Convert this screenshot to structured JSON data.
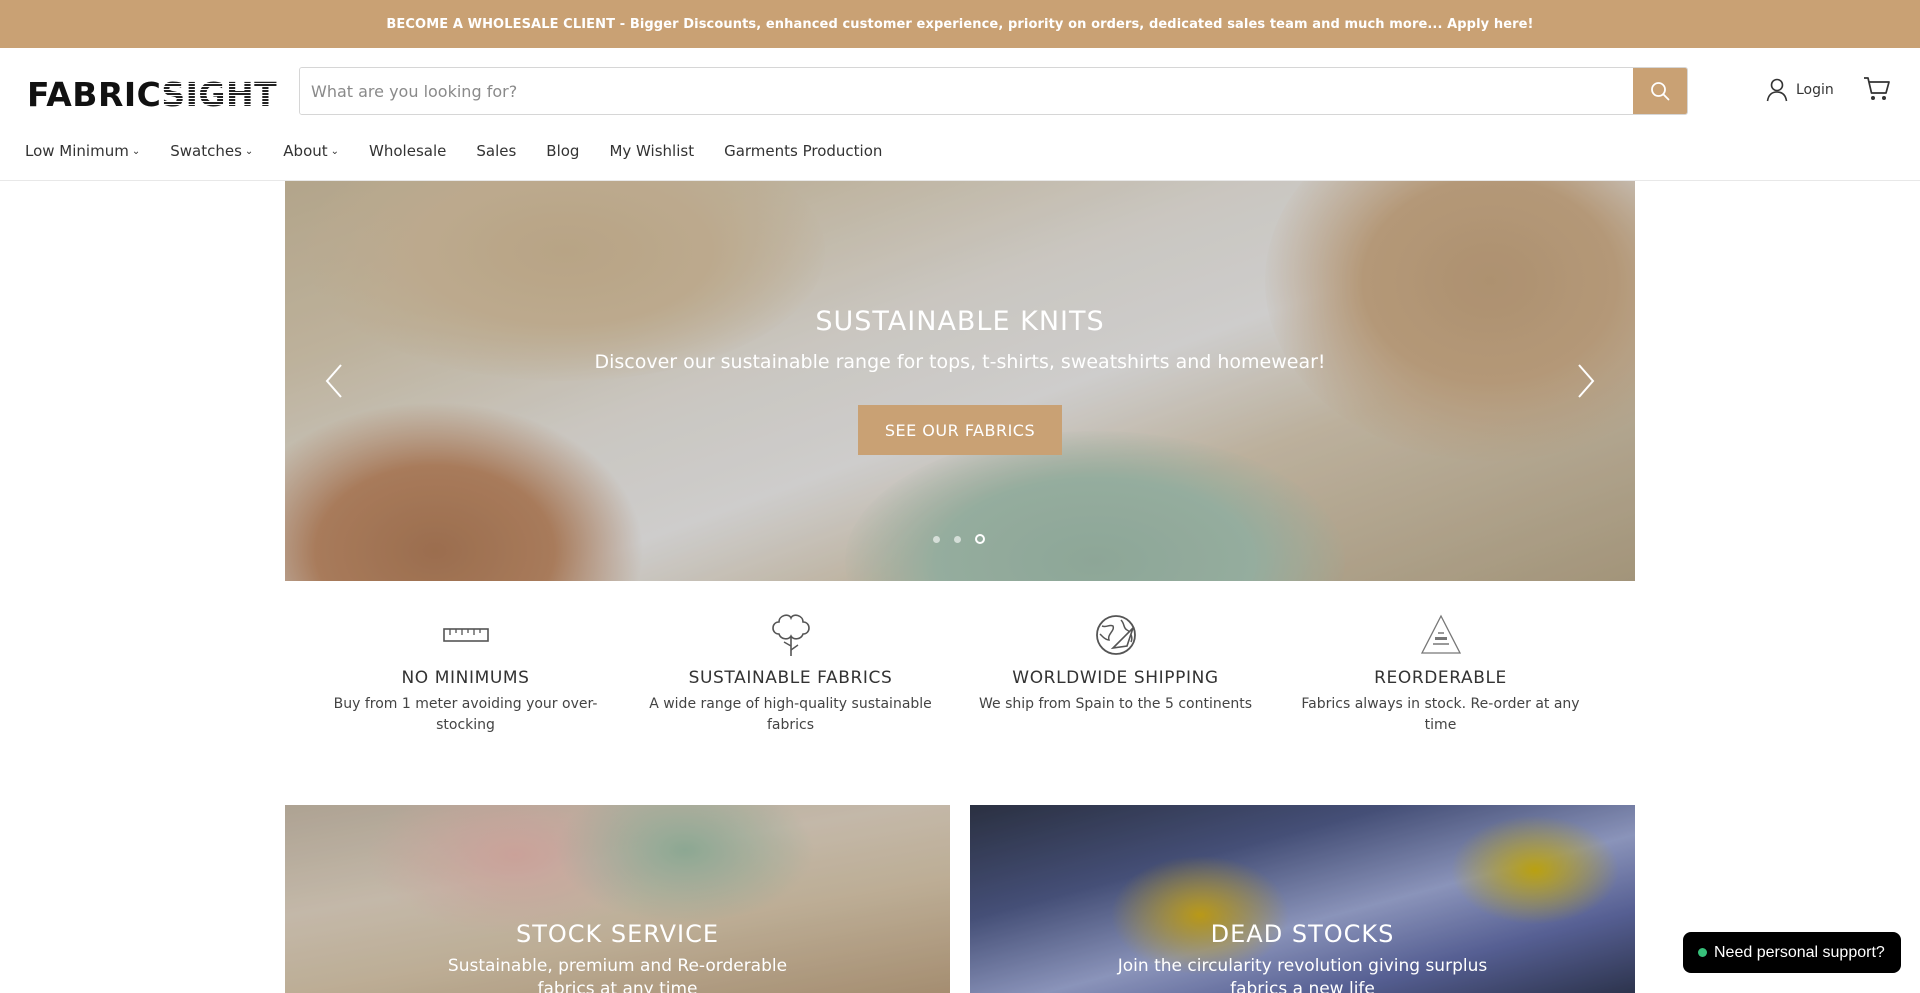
{
  "announcement": {
    "text": "BECOME A WHOLESALE CLIENT - Bigger Discounts, enhanced customer experience, priority on orders, dedicated sales team and much more... Apply here!"
  },
  "header": {
    "logo_part1": "FABRIC",
    "logo_part2": "SIGHT",
    "search_placeholder": "What are you looking for?",
    "search_icon": "search-icon",
    "login_label": "Login",
    "cart_icon": "cart-icon"
  },
  "nav": {
    "items": [
      {
        "label": "Low Minimum",
        "dropdown": true
      },
      {
        "label": "Swatches",
        "dropdown": true
      },
      {
        "label": "About",
        "dropdown": true
      },
      {
        "label": "Wholesale",
        "dropdown": false
      },
      {
        "label": "Sales",
        "dropdown": false
      },
      {
        "label": "Blog",
        "dropdown": false
      },
      {
        "label": "My Wishlist",
        "dropdown": false
      },
      {
        "label": "Garments Production",
        "dropdown": false
      }
    ]
  },
  "hero": {
    "title": "SUSTAINABLE KNITS",
    "subtitle": "Discover our sustainable range for tops, t-shirts, sweatshirts and homewear!",
    "cta": "SEE OUR FABRICS",
    "slides": 3,
    "active_slide": 3
  },
  "features": [
    {
      "icon": "ruler-icon",
      "title": "NO MINIMUMS",
      "desc": "Buy from 1 meter avoiding your over-stocking"
    },
    {
      "icon": "cotton-plant-icon",
      "title": "SUSTAINABLE FABRICS",
      "desc": "A wide range of high-quality sustainable fabrics"
    },
    {
      "icon": "globe-plane-icon",
      "title": "WORLDWIDE SHIPPING",
      "desc": "We ship from Spain to the 5 continents"
    },
    {
      "icon": "reorder-triangle-icon",
      "title": "REORDERABLE",
      "desc": "Fabrics always in stock. Re-order at any time"
    }
  ],
  "promos": [
    {
      "title": "STOCK SERVICE",
      "subtitle": "Sustainable, premium and Re-orderable fabrics at any time"
    },
    {
      "title": "DEAD STOCKS",
      "subtitle": "Join the circularity revolution giving surplus fabrics a new life"
    }
  ],
  "support": {
    "label": "Need personal support?"
  },
  "colors": {
    "accent": "#c9a174",
    "text": "#333333",
    "support_bg": "#000000",
    "online_dot": "#37c07a"
  }
}
